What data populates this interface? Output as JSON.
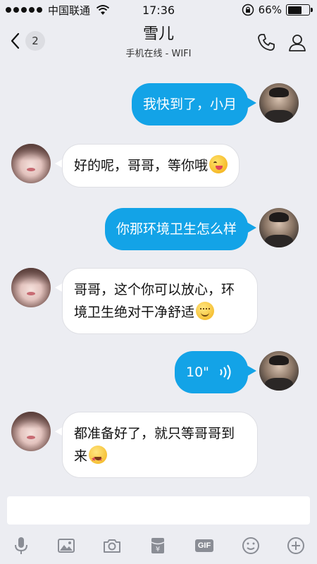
{
  "status_bar": {
    "carrier": "中国联通",
    "time": "17:36",
    "battery_text": "66%",
    "battery_level": 0.66,
    "signal_dots": 5
  },
  "header": {
    "back_badge": "2",
    "title": "雪儿",
    "subtitle": "手机在线 - WIFI"
  },
  "messages": [
    {
      "sender": "me",
      "text": "我快到了，小月"
    },
    {
      "sender": "her",
      "text": "好的呢，哥哥，等你哦",
      "emoji": "wink-tongue"
    },
    {
      "sender": "me",
      "text": "你那环境卫生怎么样"
    },
    {
      "sender": "her",
      "text_line1": "哥哥，这个你可以放心，环",
      "text_line2": "境卫生绝对干净舒适",
      "emoji": "smile"
    },
    {
      "sender": "me",
      "type": "voice",
      "duration": "10\""
    },
    {
      "sender": "her",
      "text_line1": "都准备好了，就只等哥哥到",
      "text_line2": "来",
      "emoji": "star-eyes"
    }
  ],
  "input": {
    "placeholder": ""
  },
  "toolbar": {
    "icons": [
      "microphone-icon",
      "image-icon",
      "camera-icon",
      "red-packet-icon",
      "gif-icon",
      "emoji-icon",
      "plus-icon"
    ],
    "gif_label": "GIF"
  },
  "colors": {
    "accent": "#13a3e7",
    "background": "#ecedf2",
    "icon_gray": "#8a8d95"
  }
}
